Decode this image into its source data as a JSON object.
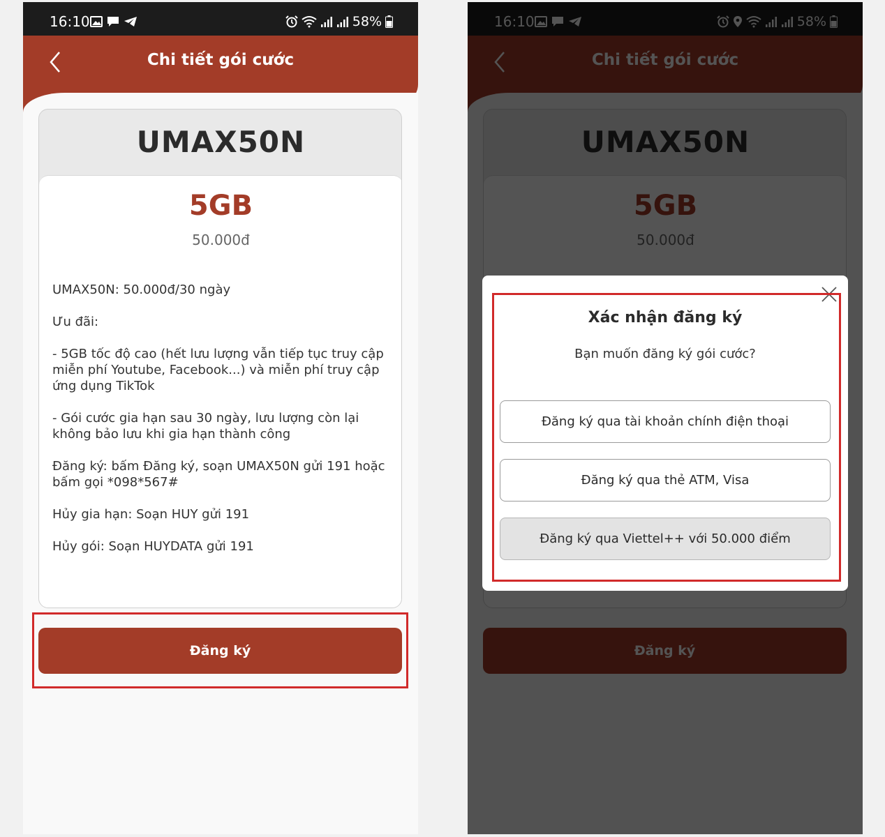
{
  "status_bar": {
    "time": "16:10",
    "battery": "58%"
  },
  "header": {
    "title": "Chi tiết gói cước"
  },
  "package": {
    "code": "UMAX50N",
    "data_size": "5GB",
    "price": "50.000đ",
    "description": [
      "UMAX50N: 50.000đ/30 ngày",
      "Ưu đãi:",
      "- 5GB tốc độ cao (hết lưu lượng vẫn tiếp tục truy cập\nmiễn phí Youtube, Facebook...) và miễn phí truy cập\nứng dụng TikTok",
      "- Gói cước gia hạn sau 30 ngày, lưu lượng còn lại\nkhông bảo lưu khi gia hạn thành công",
      "Đăng ký: bấm Đăng ký, soạn UMAX50N gửi 191 hoặc\nbấm gọi *098*567#",
      "Hủy gia hạn: Soạn HUY gửi 191",
      "Hủy gói: Soạn HUYDATA gửi 191"
    ]
  },
  "register_button": {
    "label": "Đăng ký"
  },
  "modal": {
    "title": "Xác nhận đăng ký",
    "subtitle": "Bạn muốn đăng ký gói cước?",
    "options": [
      {
        "label": "Đăng ký qua tài khoản chính điện thoại"
      },
      {
        "label": "Đăng ký qua thẻ ATM, Visa"
      },
      {
        "label": "Đăng ký qua Viettel++ với 50.000 điểm"
      }
    ]
  },
  "colors": {
    "brand": "#a33c28",
    "highlight": "#d12a2a",
    "statusbar": "#1c1c1c"
  }
}
